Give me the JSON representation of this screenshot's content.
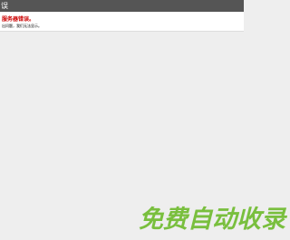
{
  "window": {
    "title": "误"
  },
  "error": {
    "title": "服务器错误。",
    "detail": "出问题，我们无法显示。"
  },
  "watermark": {
    "text": "免费自动收录"
  }
}
